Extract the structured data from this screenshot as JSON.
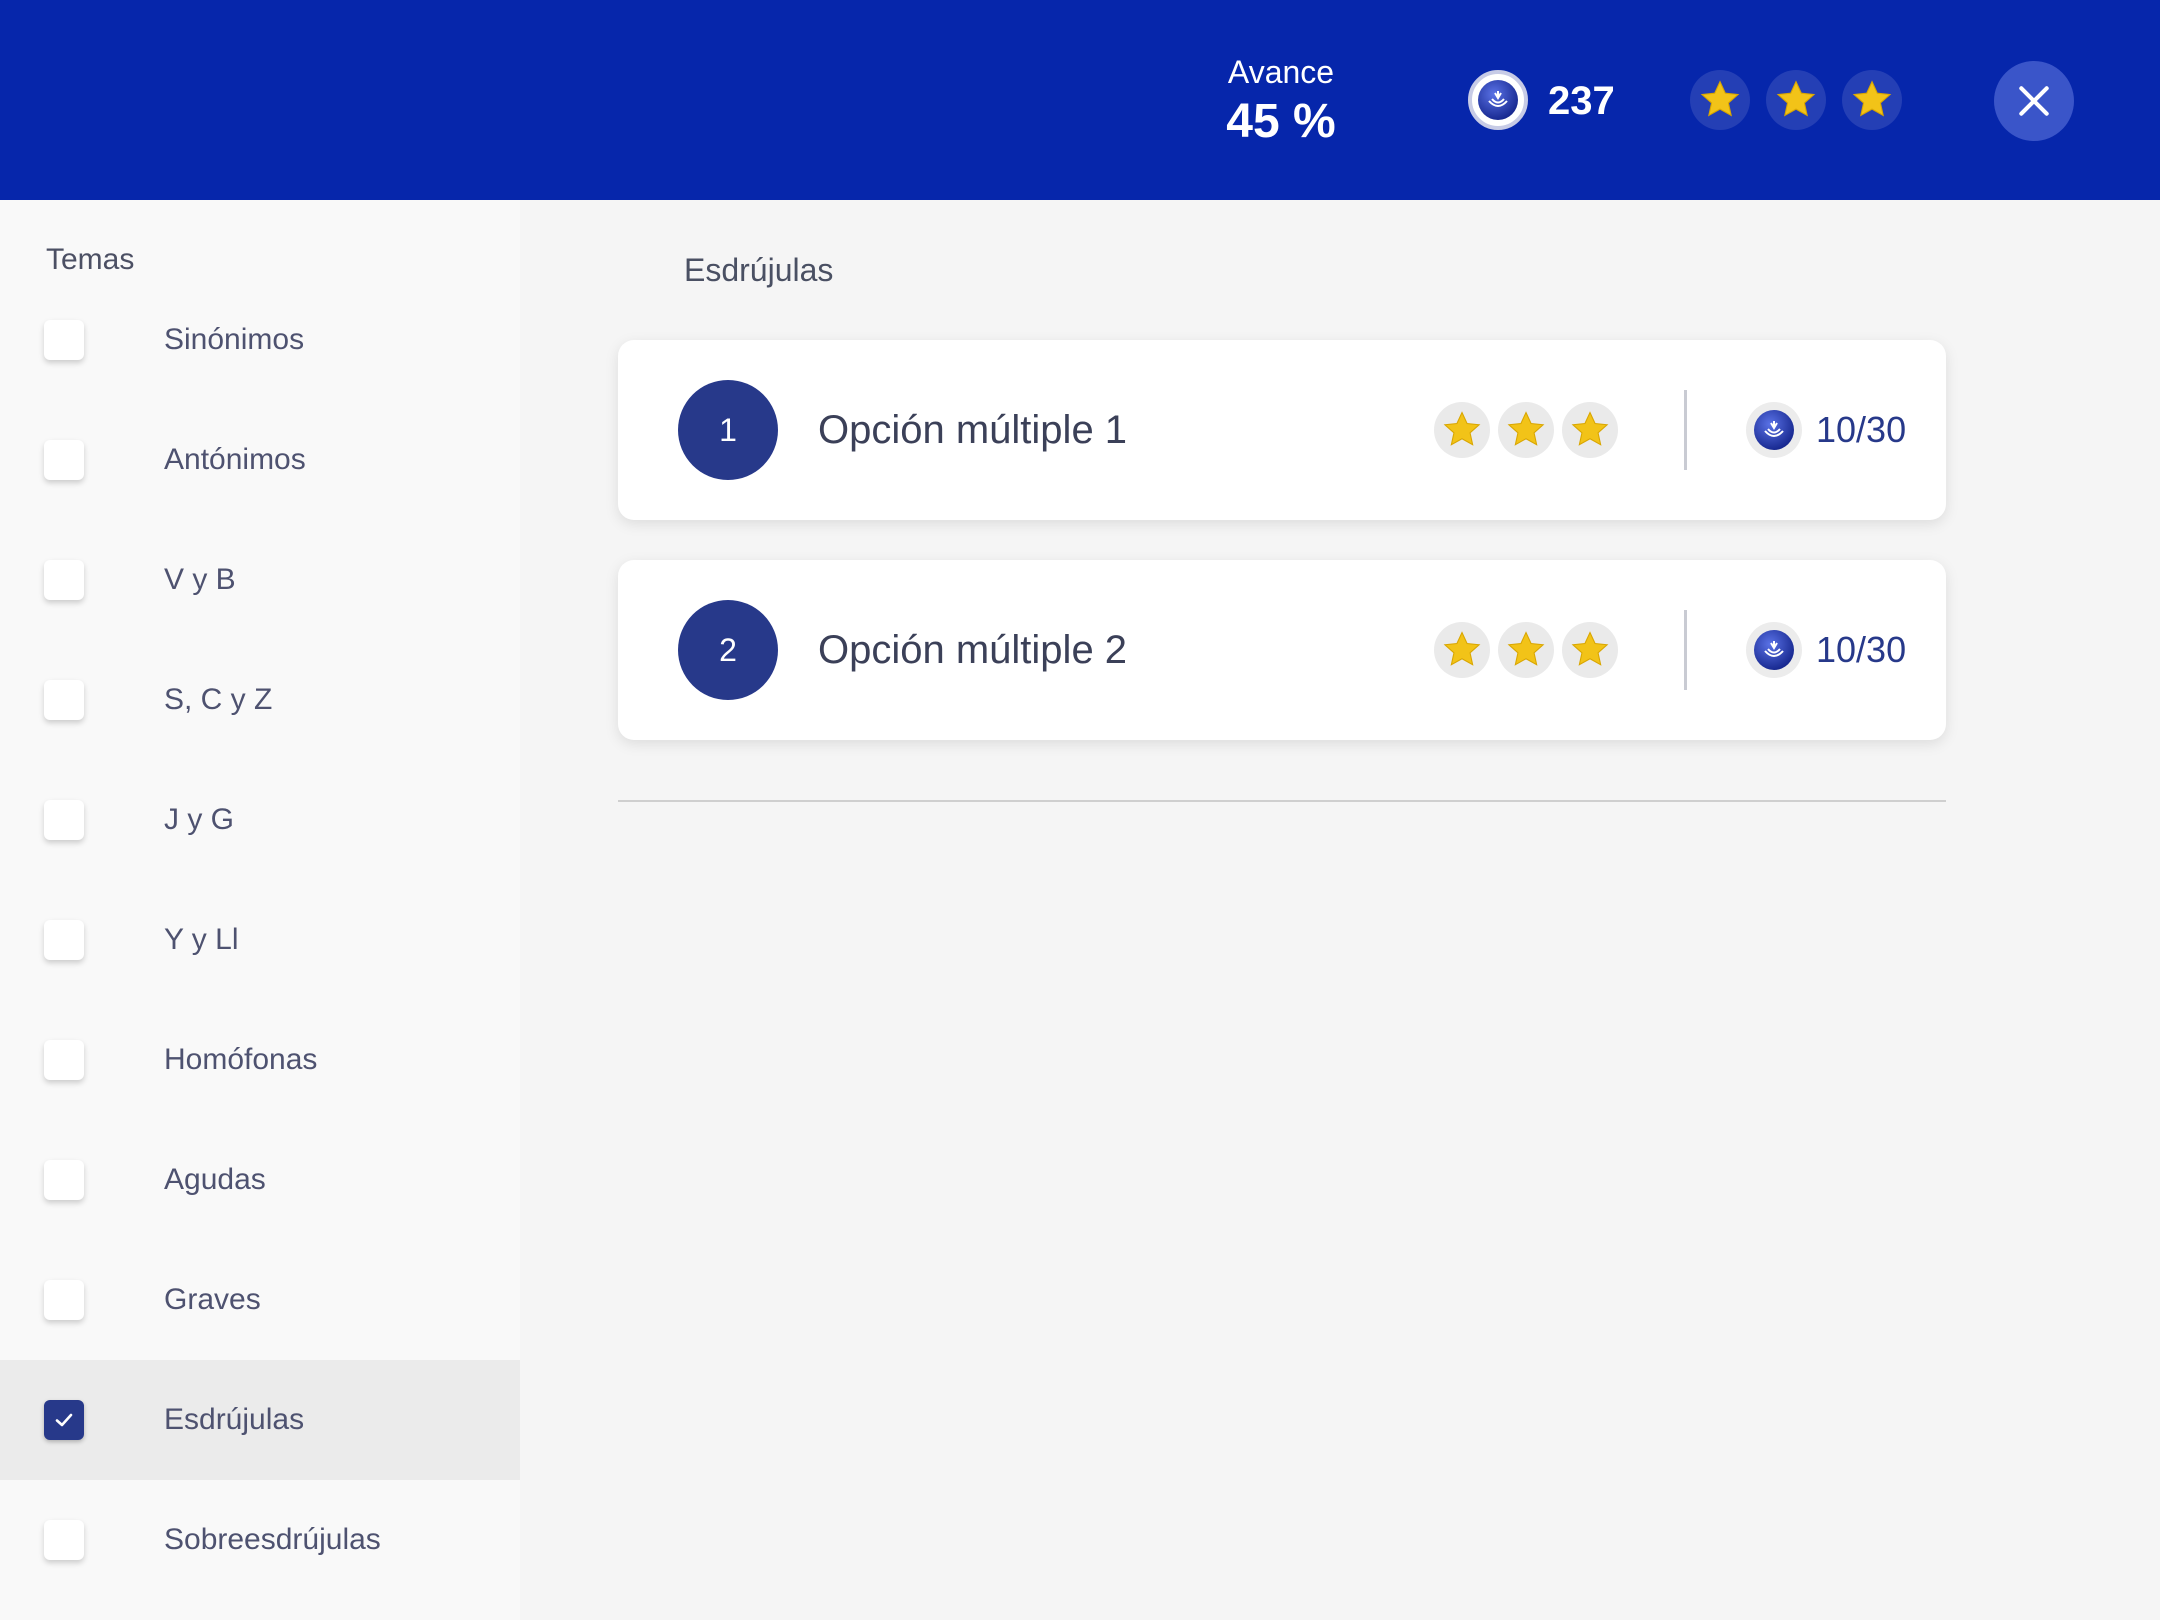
{
  "header": {
    "progress_label": "Avance",
    "progress_value": "45 %",
    "coins": "237",
    "stars": [
      "star-icon",
      "star-icon",
      "star-icon"
    ],
    "close_icon": "close-icon",
    "colors": {
      "bar": "#0626ab",
      "star": "#f2c318"
    }
  },
  "sidebar": {
    "title": "Temas",
    "items": [
      {
        "label": "Sinónimos",
        "checked": false
      },
      {
        "label": "Antónimos",
        "checked": false
      },
      {
        "label": "V y B",
        "checked": false
      },
      {
        "label": "S, C y Z",
        "checked": false
      },
      {
        "label": "J y G",
        "checked": false
      },
      {
        "label": "Y y Ll",
        "checked": false
      },
      {
        "label": "Homófonas",
        "checked": false
      },
      {
        "label": "Agudas",
        "checked": false
      },
      {
        "label": "Graves",
        "checked": false
      },
      {
        "label": "Esdrújulas",
        "checked": true
      },
      {
        "label": "Sobreesdrújulas",
        "checked": false
      }
    ]
  },
  "main": {
    "section_title": "Esdrújulas",
    "activities": [
      {
        "number": "1",
        "title": "Opción múltiple 1",
        "stars": 3,
        "score": "10/30"
      },
      {
        "number": "2",
        "title": "Opción múltiple 2",
        "stars": 3,
        "score": "10/30"
      }
    ]
  }
}
